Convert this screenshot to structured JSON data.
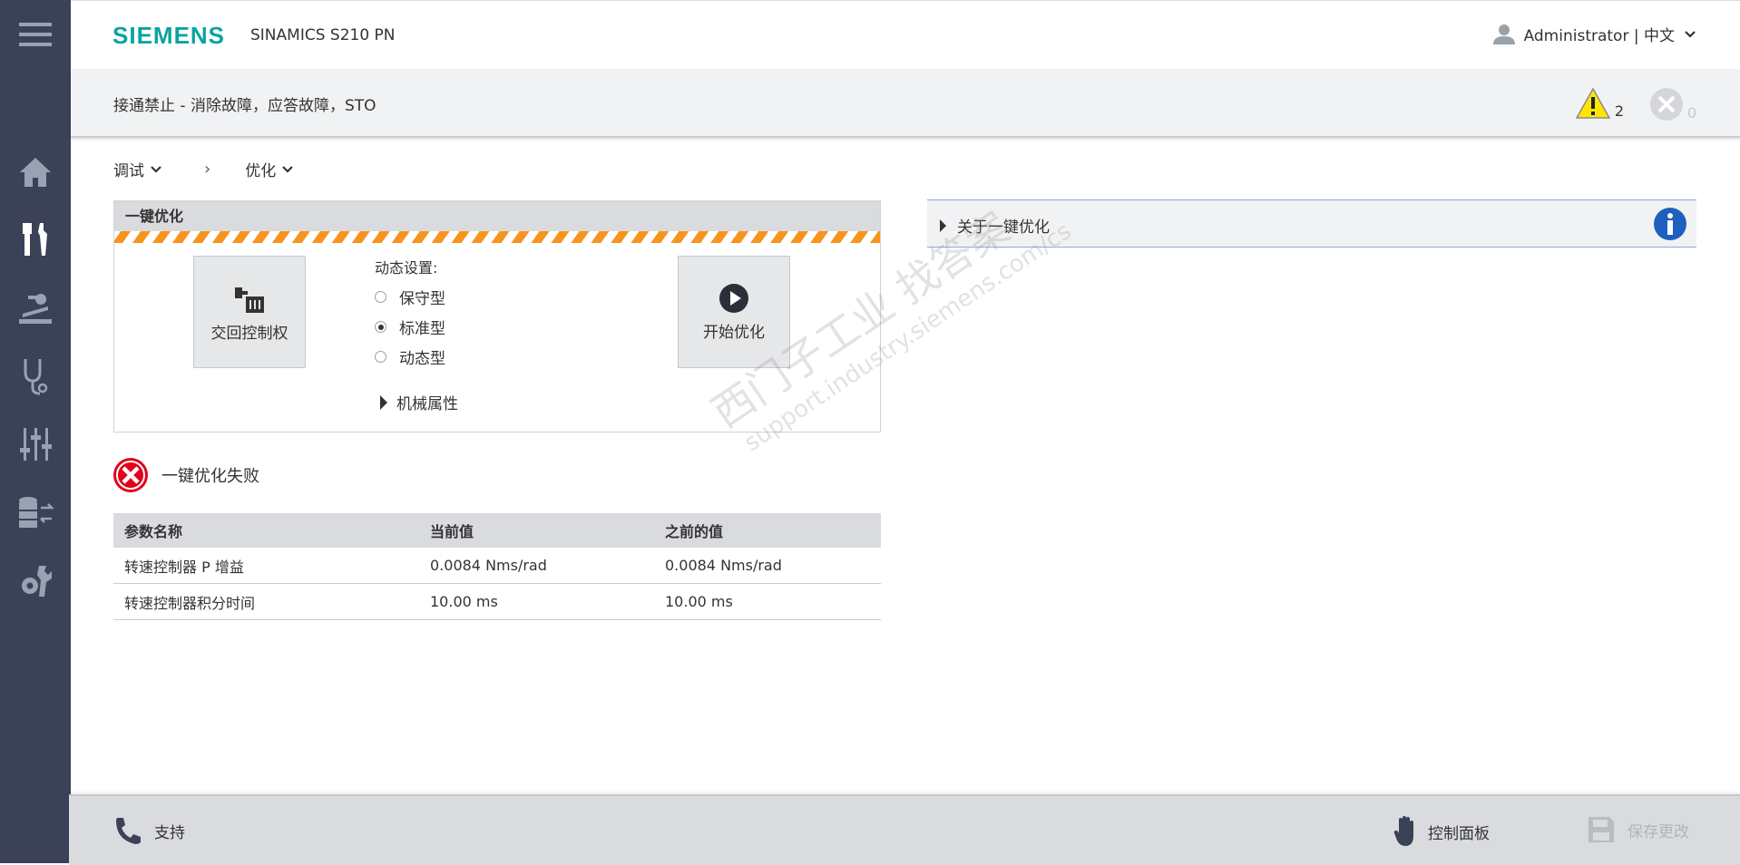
{
  "sidebar": {
    "items": [
      {
        "name": "menu-icon"
      },
      {
        "name": "home-icon"
      },
      {
        "name": "commissioning-tools-icon"
      },
      {
        "name": "drive-control-icon"
      },
      {
        "name": "diagnostics-icon"
      },
      {
        "name": "parameters-icon"
      },
      {
        "name": "backup-transfer-icon"
      },
      {
        "name": "system-settings-icon"
      }
    ],
    "bg_color": "#3b4257"
  },
  "header": {
    "logo": "SIEMENS",
    "product": "SINAMICS S210 PN",
    "user": "Administrator | 中文"
  },
  "statusbar": {
    "text": "接通禁止 - 消除故障，应答故障，STO",
    "warning_count": "2",
    "error_count": "0"
  },
  "breadcrumb": {
    "level1": "调试",
    "level2": "优化"
  },
  "panel": {
    "title": "一键优化",
    "return_control_label": "交回控制权",
    "dynamic_label": "动态设置:",
    "options": [
      {
        "label": "保守型",
        "selected": false
      },
      {
        "label": "标准型",
        "selected": true
      },
      {
        "label": "动态型",
        "selected": false
      }
    ],
    "mechanical_label": "机械属性",
    "start_label": "开始优化"
  },
  "result": {
    "message": "一键优化失败"
  },
  "table": {
    "headers": [
      "参数名称",
      "当前值",
      "之前的值"
    ],
    "rows": [
      [
        "转速控制器 P 增益",
        "0.0084 Nms/rad",
        "0.0084 Nms/rad"
      ],
      [
        "转速控制器积分时间",
        "10.00 ms",
        "10.00 ms"
      ]
    ]
  },
  "info_panel": {
    "label": "关于一键优化"
  },
  "footer": {
    "support": "支持",
    "control_panel": "控制面板",
    "save_changes": "保存更改"
  },
  "watermark": {
    "line1": "西门子工业   找答案",
    "line2": "support.industry.siemens.com/cs"
  },
  "colors": {
    "brand": "#0aa3a0",
    "hazard": "#f7941d",
    "error": "#e2001a",
    "info": "#1f5fbf"
  }
}
